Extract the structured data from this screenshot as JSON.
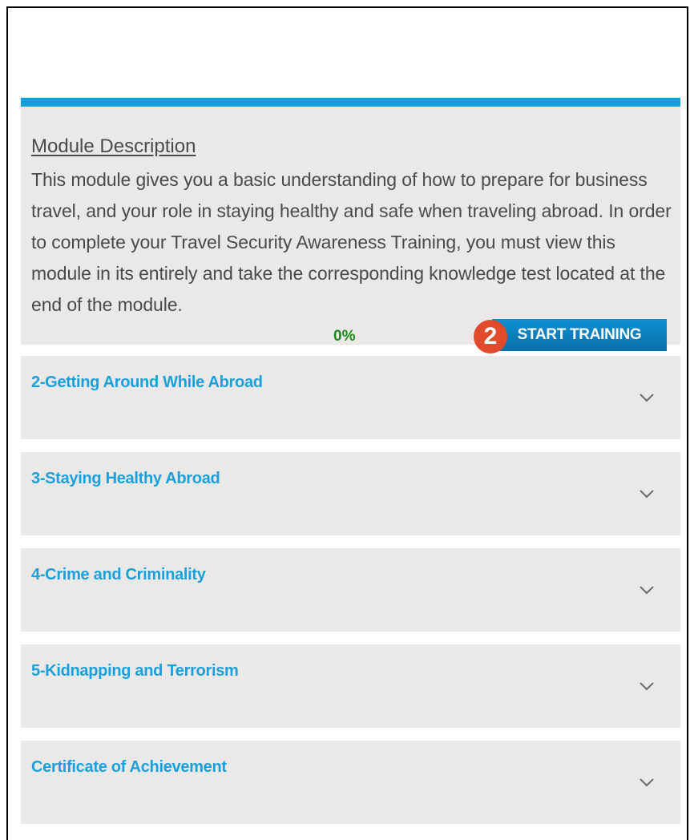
{
  "module": {
    "description_title": "Module Description",
    "description_body": "This module gives you a basic understanding of how to prepare for business travel, and your role in staying healthy and safe when traveling abroad. In order to complete your Travel Security Awareness Training, you must view this module in its entirely and take the corresponding knowledge test located at the end of the module.",
    "progress_label": "0%",
    "progress_value": 0,
    "step_badge": "2",
    "start_button_label": "START TRAINING",
    "accent_color": "#0fa0dc"
  },
  "sections": [
    {
      "title": "2-Getting Around While Abroad"
    },
    {
      "title": "3-Staying Healthy Abroad"
    },
    {
      "title": "4-Crime and Criminality"
    },
    {
      "title": "5-Kidnapping and Terrorism"
    },
    {
      "title": "Certificate of Achievement"
    }
  ],
  "icons": {
    "expand": "chevron-down-icon"
  }
}
